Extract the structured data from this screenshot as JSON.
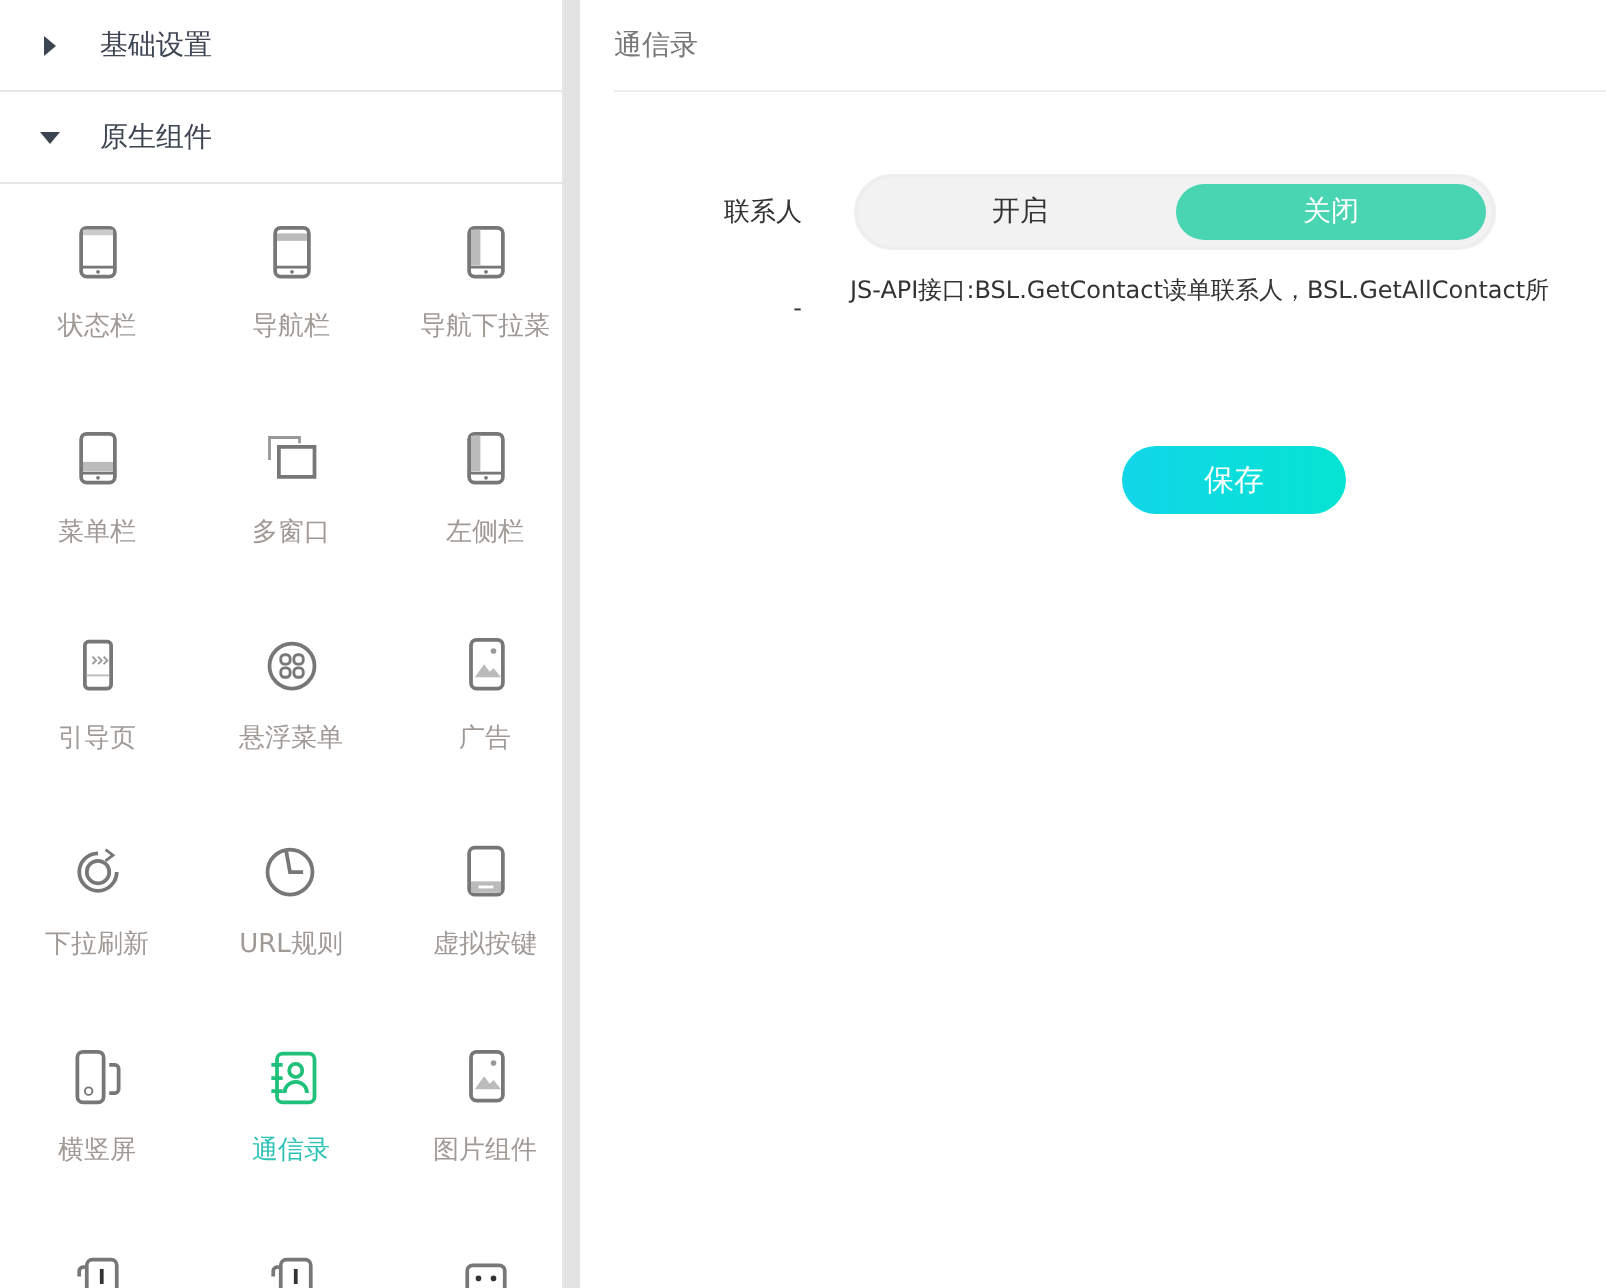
{
  "sidebar": {
    "sections": [
      {
        "title": "基础设置",
        "expanded": false
      },
      {
        "title": "原生组件",
        "expanded": true
      }
    ],
    "items": [
      {
        "kind": "status-bar",
        "label": "状态栏",
        "selected": false
      },
      {
        "kind": "nav-bar",
        "label": "导航栏",
        "selected": false
      },
      {
        "kind": "side-bar",
        "label": "导航下拉菜",
        "selected": false
      },
      {
        "kind": "menu-bar",
        "label": "菜单栏",
        "selected": false
      },
      {
        "kind": "windows",
        "label": "多窗口",
        "selected": false
      },
      {
        "kind": "side-bar",
        "label": "左侧栏",
        "selected": false
      },
      {
        "kind": "guide",
        "label": "引导页",
        "selected": false
      },
      {
        "kind": "float-menu",
        "label": "悬浮菜单",
        "selected": false
      },
      {
        "kind": "image-phone",
        "label": "广告",
        "selected": false
      },
      {
        "kind": "refresh",
        "label": "下拉刷新",
        "selected": false
      },
      {
        "kind": "clock",
        "label": "URL规则",
        "selected": false
      },
      {
        "kind": "keys",
        "label": "虚拟按键",
        "selected": false
      },
      {
        "kind": "rotate",
        "label": "横竖屏",
        "selected": false
      },
      {
        "kind": "contacts",
        "label": "通信录",
        "selected": true
      },
      {
        "kind": "image-phone",
        "label": "图片组件",
        "selected": false
      },
      {
        "kind": "alert",
        "selected": false
      },
      {
        "kind": "alert",
        "selected": false
      },
      {
        "kind": "face",
        "selected": false
      }
    ]
  },
  "panel": {
    "title": "通信录",
    "field": {
      "label": "联系人",
      "options": [
        {
          "label": "开启",
          "selected": false
        },
        {
          "label": "关闭",
          "selected": true
        }
      ],
      "marker": "-",
      "description": "JS-API接口:BSL.GetContact读单联系人，BSL.GetAllContact所"
    },
    "save_button": "保存"
  }
}
